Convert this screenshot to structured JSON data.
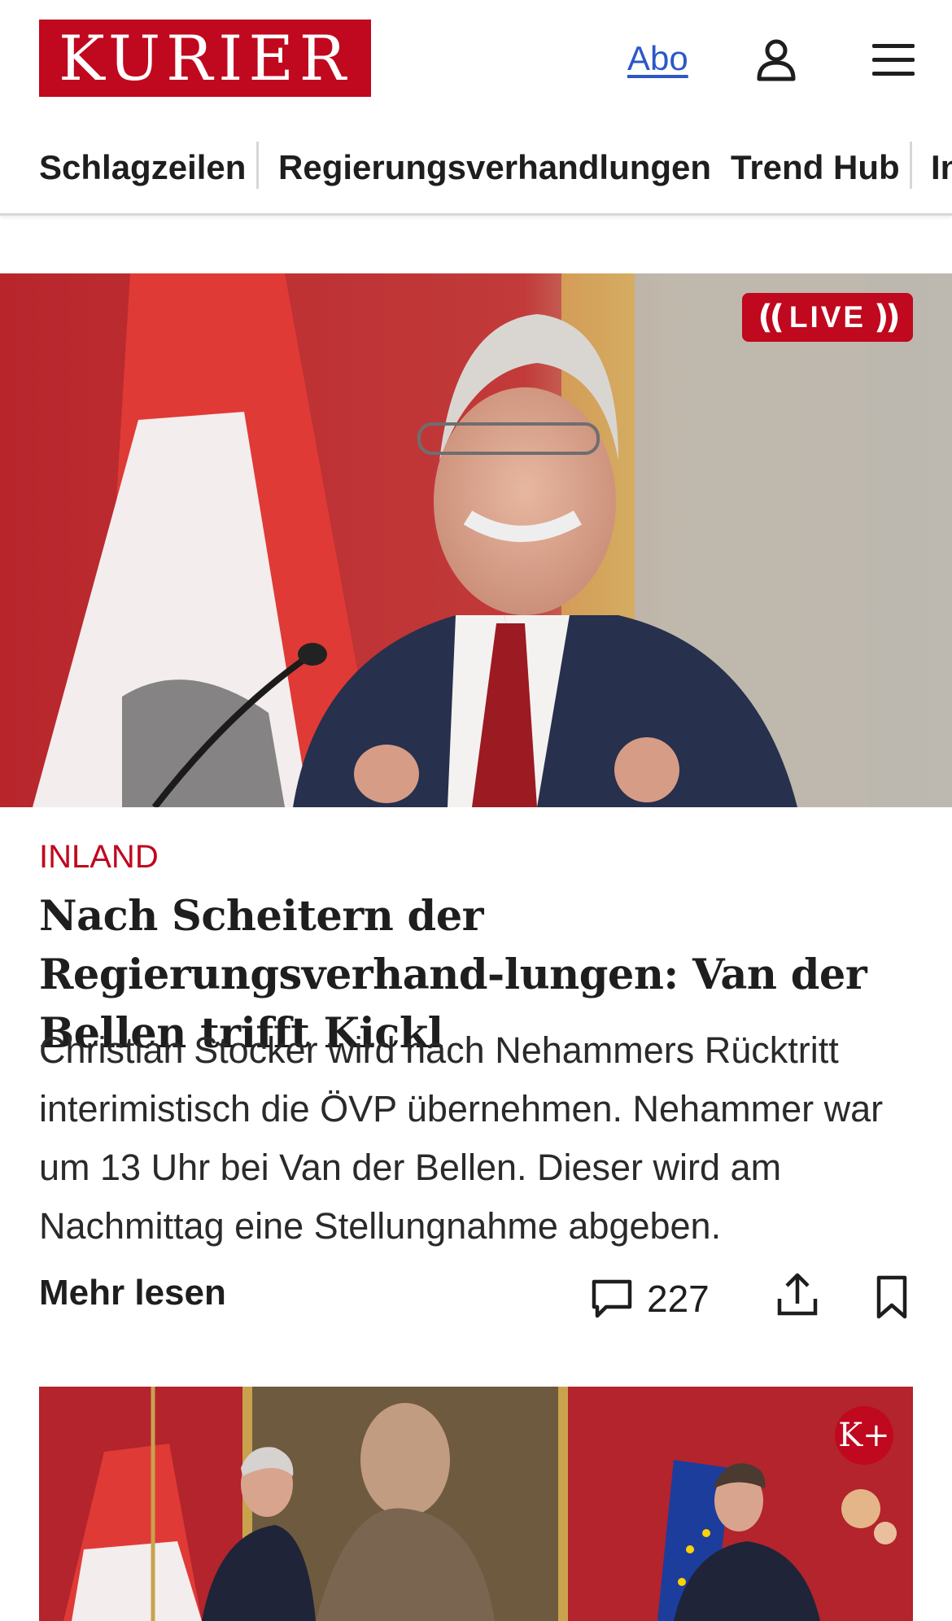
{
  "header": {
    "logo": "KURIER",
    "abo_label": "Abo"
  },
  "nav": {
    "items": [
      "Schlagzeilen",
      "Regierungsverhandlungen",
      "Trend Hub",
      "In"
    ]
  },
  "lead_article": {
    "live_label": "LIVE",
    "kicker": "INLAND",
    "headline": "Nach Scheitern der Regierungsverhand-lungen: Van der Bellen trifft Kickl",
    "teaser": "Christian Stocker wird nach Nehammers Rücktritt interimistisch die ÖVP übernehmen. Nehammer war um 13 Uhr bei Van der Bellen. Dieser wird am Nachmittag eine Stellungnahme abgeben.",
    "more_label": "Mehr lesen",
    "comment_count": "227"
  },
  "second_article": {
    "badge": "K+"
  },
  "colors": {
    "brand_red": "#c0081e",
    "link_blue": "#2b58c8",
    "text": "#1e1e1e"
  },
  "icons": [
    "user-icon",
    "hamburger-menu-icon",
    "comment-icon",
    "share-icon",
    "bookmark-icon"
  ]
}
